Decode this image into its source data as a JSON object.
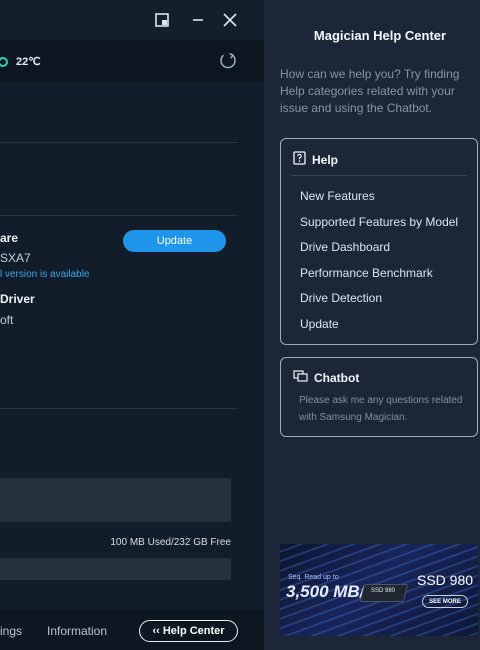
{
  "window": {
    "restore_icon": "restore-window-icon",
    "minimize_icon": "minimize-icon",
    "close_icon": "close-icon"
  },
  "status": {
    "temperature": "22℃",
    "refresh_icon": "refresh-icon"
  },
  "firmware": {
    "title": "are",
    "version": "SXA7",
    "note": "l version is available",
    "update_label": "Update"
  },
  "driver": {
    "title": "Driver",
    "value": "oft"
  },
  "storage": {
    "usage_text": "100 MB Used/232 GB Free"
  },
  "bottom_nav": {
    "settings_label": "ings",
    "information_label": "Information",
    "help_center_label": "‹‹ Help Center"
  },
  "help_panel": {
    "title": "Magician Help Center",
    "intro": "How can we help you? Try finding Help categories related with your issue and using the Chatbot.",
    "help_card": {
      "title": "Help",
      "links": [
        "New Features",
        "Supported Features by Model",
        "Drive Dashboard",
        "Performance Benchmark",
        "Drive Detection",
        "Update"
      ]
    },
    "chatbot_card": {
      "title": "Chatbot",
      "text": "Please ask me any questions related with Samsung Magician."
    },
    "ad": {
      "small_text": "Seq. Read up to",
      "speed": "3,500 MB/s",
      "chip_label": "SSD 980",
      "brand": "SSD 980",
      "button": "SEE MORE"
    }
  },
  "colors": {
    "accent": "#1c95ea",
    "background": "#121d2b",
    "help_panel_background": "#1b2738",
    "temperature_indicator": "#2fd1a6"
  }
}
